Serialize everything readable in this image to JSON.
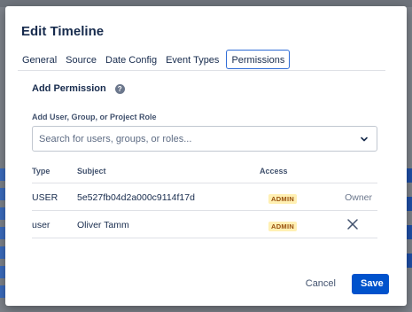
{
  "dialog": {
    "title": "Edit Timeline"
  },
  "tabs": [
    {
      "label": "General",
      "active": false
    },
    {
      "label": "Source",
      "active": false
    },
    {
      "label": "Date Config",
      "active": false
    },
    {
      "label": "Event Types",
      "active": false
    },
    {
      "label": "Permissions",
      "active": true
    }
  ],
  "permissions": {
    "heading": "Add Permission",
    "help_icon": "?",
    "field_label": "Add User, Group, or Project Role",
    "search_placeholder": "Search for users, groups, or roles...",
    "columns": {
      "type": "Type",
      "subject": "Subject",
      "access": "Access"
    },
    "rows": [
      {
        "type": "USER",
        "subject": "5e527fb04d2a000c9114f17d",
        "access": "ADMIN",
        "action": "Owner"
      },
      {
        "type": "user",
        "subject": "Oliver Tamm",
        "access": "ADMIN",
        "action": "close-icon"
      }
    ]
  },
  "footer": {
    "cancel_label": "Cancel",
    "save_label": "Save"
  },
  "colors": {
    "accent": "#0052cc",
    "tab_border": "#2d6bd6",
    "badge_bg": "#fff0b3",
    "badge_text": "#974f0c"
  }
}
